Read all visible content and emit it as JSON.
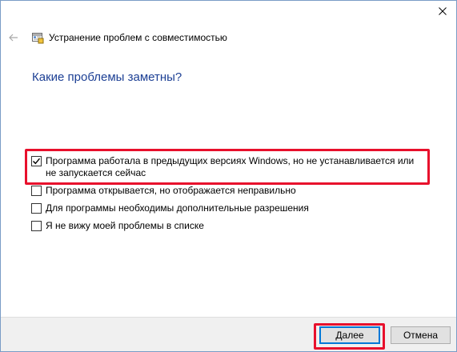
{
  "window": {
    "title": "Устранение проблем с совместимостью",
    "icons": {
      "back": "back-arrow-icon",
      "app": "compatibility-troubleshooter-icon",
      "close": "close-icon"
    }
  },
  "main": {
    "heading": "Какие проблемы заметны?",
    "options": [
      {
        "label": "Программа работала в предыдущих версиях Windows, но не устанавливается или не запускается сейчас",
        "checked": true
      },
      {
        "label": "Программа открывается, но отображается неправильно",
        "checked": false
      },
      {
        "label": "Для программы необходимы дополнительные разрешения",
        "checked": false
      },
      {
        "label": "Я не вижу моей проблемы в списке",
        "checked": false
      }
    ]
  },
  "footer": {
    "next_label": "Далее",
    "cancel_label": "Отмена"
  },
  "colors": {
    "heading": "#1c3f94",
    "highlight": "#e8102c",
    "focus": "#0078d7"
  }
}
